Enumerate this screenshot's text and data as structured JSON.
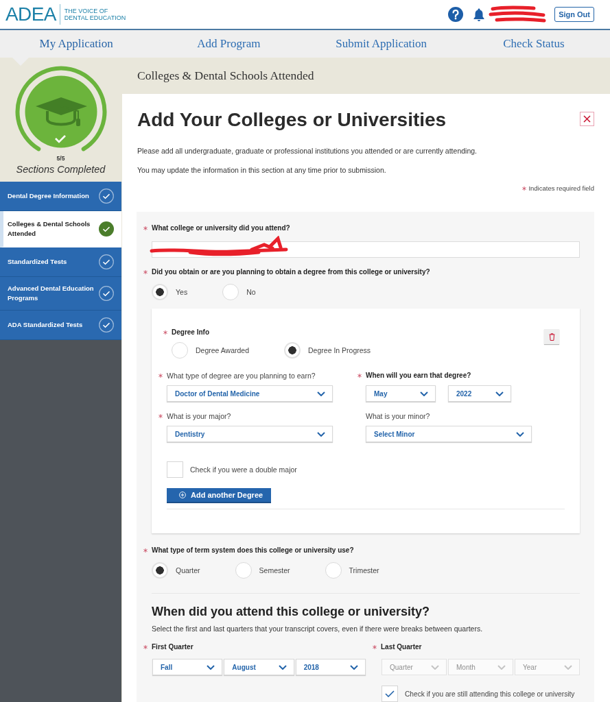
{
  "header": {
    "logo": {
      "name": "ADEA",
      "tagline_lines": [
        "THE VOICE OF",
        "DENTAL EDUCATION"
      ]
    },
    "account": {
      "name_redacted": true
    },
    "sign_out": "Sign Out"
  },
  "tabs": [
    {
      "label": "My Application",
      "selected": true
    },
    {
      "label": "Add Program",
      "selected": false
    },
    {
      "label": "Submit Application",
      "selected": false
    },
    {
      "label": "Check Status",
      "selected": false
    }
  ],
  "page_title": "Colleges & Dental Schools Attended",
  "sidebar": {
    "progress": {
      "level": 1,
      "count": "5/5",
      "caption": "Sections Completed"
    },
    "items": [
      {
        "label": "Dental Degree Information",
        "completed": true,
        "selected": false
      },
      {
        "label": "Colleges & Dental Schools Attended",
        "completed": true,
        "selected": true
      },
      {
        "label": "Standardized Tests",
        "completed": true,
        "selected": false
      },
      {
        "label": "Advanced Dental Education Programs",
        "completed": true,
        "selected": false
      },
      {
        "label": "ADA Standardized Tests",
        "completed": true,
        "selected": false
      }
    ]
  },
  "main": {
    "title": "Add Your Colleges or Universities",
    "intro": [
      "Please add all undergraduate, graduate or professional institutions you attended or are currently attending.",
      "You may update the information in this section at any time prior to submission."
    ],
    "required_note": "Indicates required field",
    "college": {
      "label": "What college or university did you attend?",
      "required": true,
      "value_redacted": true
    },
    "has_degree": {
      "label": "Did you obtain or are you planning to obtain a degree from this college or university?",
      "required": true,
      "options": [
        {
          "label": "Yes",
          "selected": true
        },
        {
          "label": "No",
          "selected": false
        }
      ]
    },
    "degree": {
      "label": "Degree Info",
      "required": true,
      "status_options": [
        {
          "label": "Degree Awarded",
          "selected": false
        },
        {
          "label": "Degree In Progress",
          "selected": true
        }
      ],
      "degree_type": {
        "label": "What type of degree are you planning to earn?",
        "required": true,
        "value": "Doctor of Dental Medicine"
      },
      "earn_date": {
        "label": "When will you earn that degree?",
        "required": true,
        "selects": [
          {
            "value": "May"
          },
          {
            "value": "2022"
          }
        ]
      },
      "major": {
        "label": "What is your major?",
        "required": true,
        "value": "Dentistry"
      },
      "minor": {
        "label": "What is your minor?",
        "required": false,
        "value": "Select Minor"
      },
      "double_major": {
        "label": "Check if you were a double major",
        "checked": false
      },
      "add_button": "Add another Degree"
    },
    "term_system": {
      "label": "What type of term system does this college or university use?",
      "required": true,
      "options": [
        {
          "label": "Quarter",
          "selected": true
        },
        {
          "label": "Semester",
          "selected": false
        },
        {
          "label": "Trimester",
          "selected": false
        }
      ]
    },
    "attendance": {
      "title": "When did you attend this college or university?",
      "hint": "Select the first and last quarters that your transcript covers, even if there were breaks between quarters.",
      "first": {
        "label": "First Quarter",
        "required": true,
        "selects": [
          {
            "value": "Fall",
            "disabled": false
          },
          {
            "value": "August",
            "disabled": false
          },
          {
            "value": "2018",
            "disabled": false
          }
        ]
      },
      "last": {
        "label": "Last Quarter",
        "required": true,
        "selects": [
          {
            "placeholder": "Quarter",
            "disabled": true
          },
          {
            "placeholder": "Month",
            "disabled": true
          },
          {
            "placeholder": "Year",
            "disabled": true
          }
        ]
      },
      "still_attending": {
        "label": "Check if you are still attending this college or university",
        "checked": true
      }
    }
  }
}
